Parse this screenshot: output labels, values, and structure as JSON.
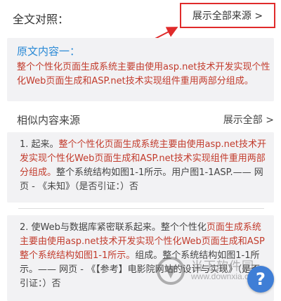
{
  "header": {
    "title": "全文对照：",
    "show_all_sources": "展示全部来源 >"
  },
  "original": {
    "title": "原文内容一：",
    "text": "整个个性化页面生成系统主要由使用asp.net技术开发实现个性化Web页面生成和ASP.net技术实现组件重用两部分组成。"
  },
  "similar": {
    "label": "相似内容来源",
    "show_all": "展示全部 >"
  },
  "items": [
    {
      "prefix": "1. 起来。",
      "highlight": "整个个性化页面生成系统主要由使用asp.net技术开发实现个性化Web页面生成和ASP.net技术实现组件重用两部分组成。",
      "suffix": "整个系统结构如图1-1所示。用户图1-1ASP.—— 网页 - 《未知》（是否引证：）否"
    },
    {
      "prefix": "2. 使Web与数据库紧密联系起来。整个个性化",
      "highlight": "页面生成系统主要由使用asp.net技术开发实现个性化Web页面生成和ASP整个系统结构如图1-1所示。",
      "suffix": "组成。整个系统结构如图1-1所示。—— 网页 - 《【参考】电影院网站的设计与实现》（是否引证：）否"
    }
  ],
  "help_icon": "?",
  "watermark": {
    "text1": "当下软件园",
    "text2": "www.downxia.com"
  },
  "colors": {
    "accent_blue": "#2b8ad6",
    "highlight_red": "#c23b2c",
    "annotation_red": "#e02b2b",
    "panel_bg": "#f2f2f4"
  }
}
